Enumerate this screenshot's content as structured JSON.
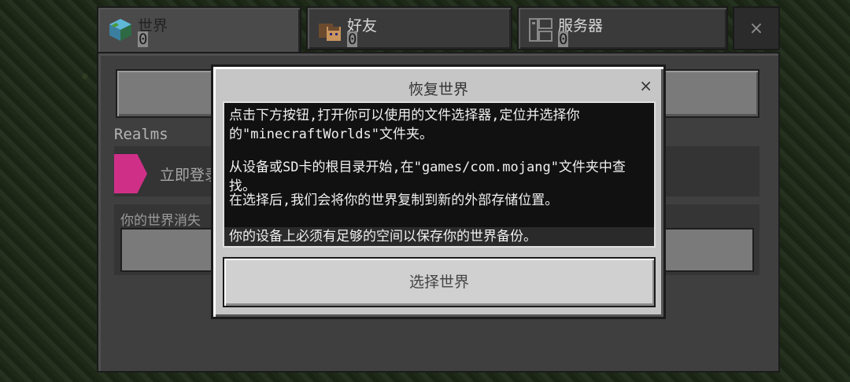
{
  "tabs": [
    {
      "label": "世界",
      "count": "0"
    },
    {
      "label": "好友",
      "count": "0"
    },
    {
      "label": "服务器",
      "count": "0"
    }
  ],
  "tab_close": "×",
  "background": {
    "realms_label": "Realms",
    "realms_text": "立即登录",
    "lost_worlds_text": "你的世界消失"
  },
  "dialog": {
    "title": "恢复世界",
    "close": "×",
    "paragraphs": [
      "点击下方按钮,打开你可以使用的文件选择器,定位并选择你的\"minecraftWorlds\"文件夹。",
      "从设备或SD卡的根目录开始,在\"games/com.mojang\"文件夹中查找。",
      "在选择后,我们会将你的世界复制到新的外部存储位置。",
      "你的设备上必须有足够的空间以保存你的世界备份。"
    ],
    "button_label": "选择世界"
  },
  "colors": {
    "dialog_bg": "#c6c6c6",
    "message_bg": "#111111",
    "realms_accent": "#d02f88"
  }
}
